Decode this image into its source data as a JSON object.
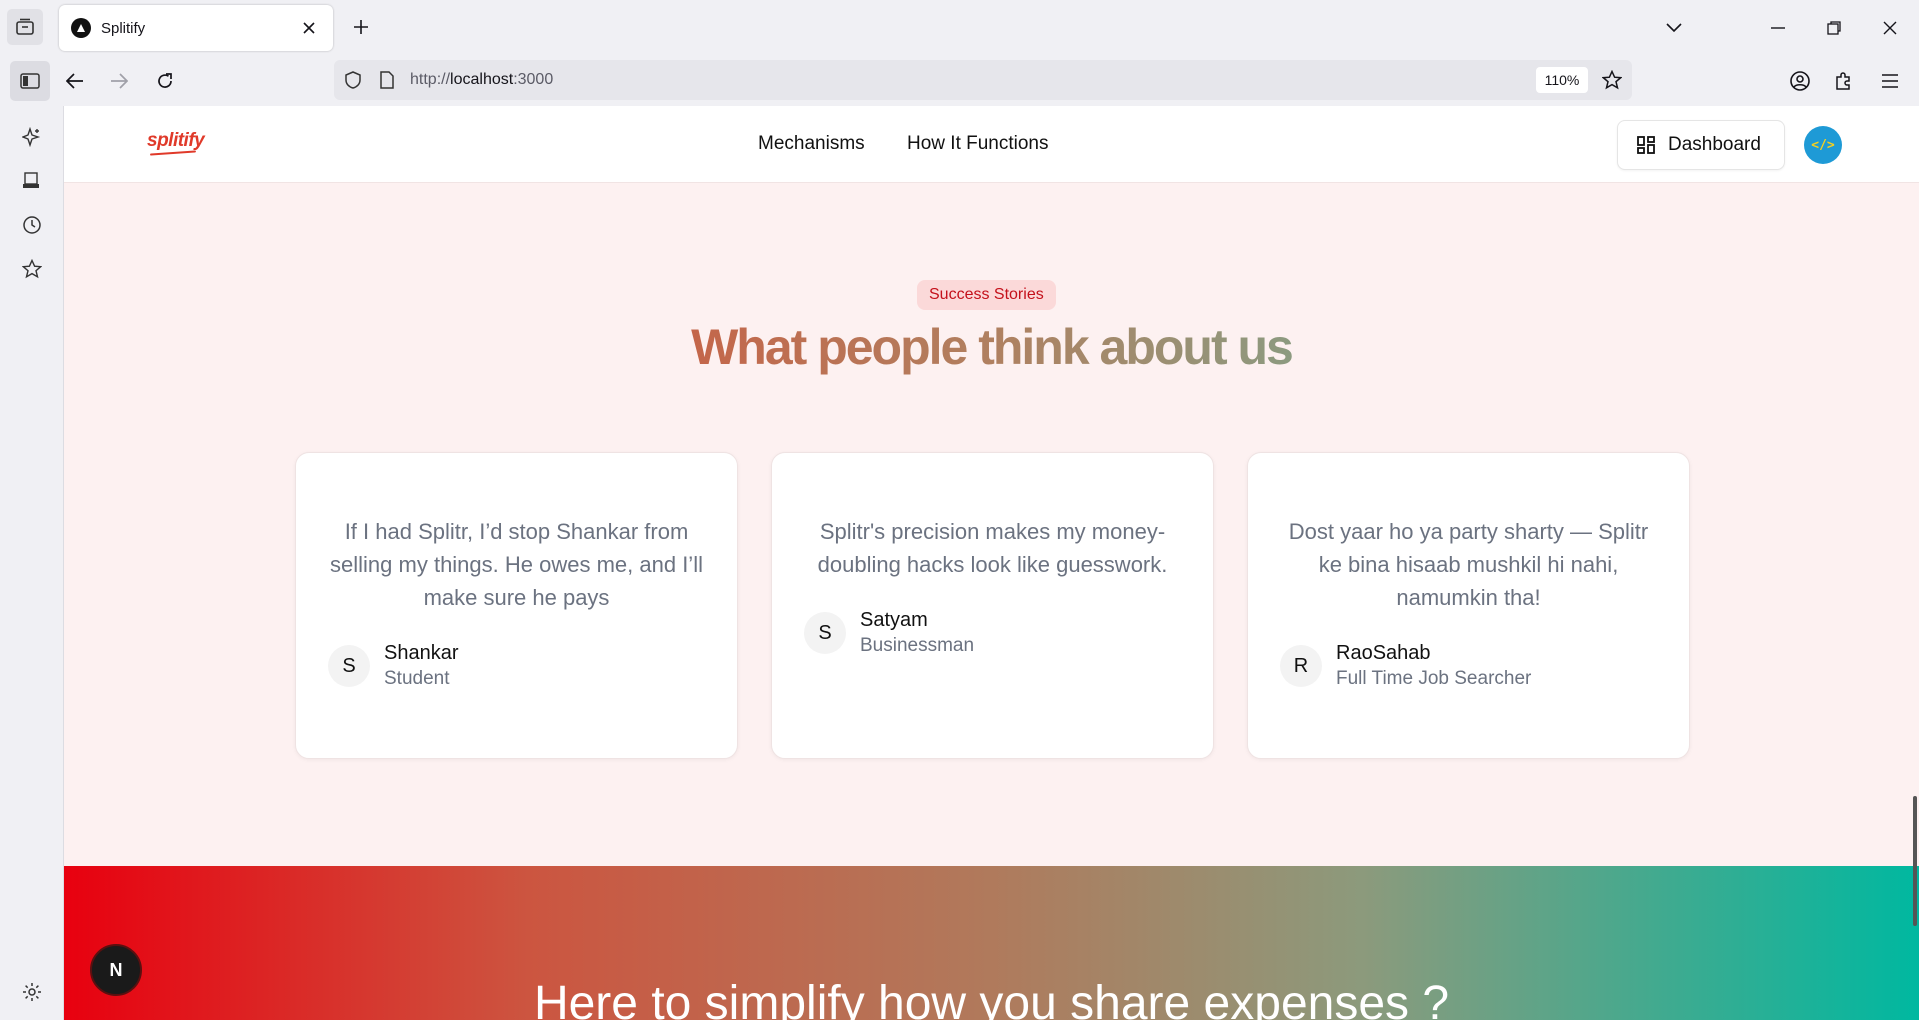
{
  "browser": {
    "tab_title": "Splitify",
    "url_prefix": "http://",
    "url_host": "localhost",
    "url_suffix": ":3000",
    "zoom": "110%"
  },
  "site": {
    "logo": "splitify",
    "nav": [
      "Mechanisms",
      "How It Functions"
    ],
    "dashboard_label": "Dashboard",
    "avatar_glyph": "</>"
  },
  "section": {
    "badge": "Success Stories",
    "heading": "What people think about us"
  },
  "testimonials": [
    {
      "quote": "If I had Splitr, I’d stop Shankar from selling my things. He owes me, and I’ll make sure he pays",
      "initial": "S",
      "name": "Shankar",
      "role": "Student"
    },
    {
      "quote": "Splitr's precision makes my money-doubling hacks look like guesswork.",
      "initial": "S",
      "name": "Satyam",
      "role": "Businessman"
    },
    {
      "quote": "Dost yaar ho ya party sharty — Splitr ke bina hisaab mushkil hi nahi, namumkin tha!",
      "initial": "R",
      "name": "RaoSahab",
      "role": "Full Time Job Searcher"
    }
  ],
  "cta": {
    "text": "Here to simplify how you share expenses ?"
  },
  "next_badge": "N"
}
